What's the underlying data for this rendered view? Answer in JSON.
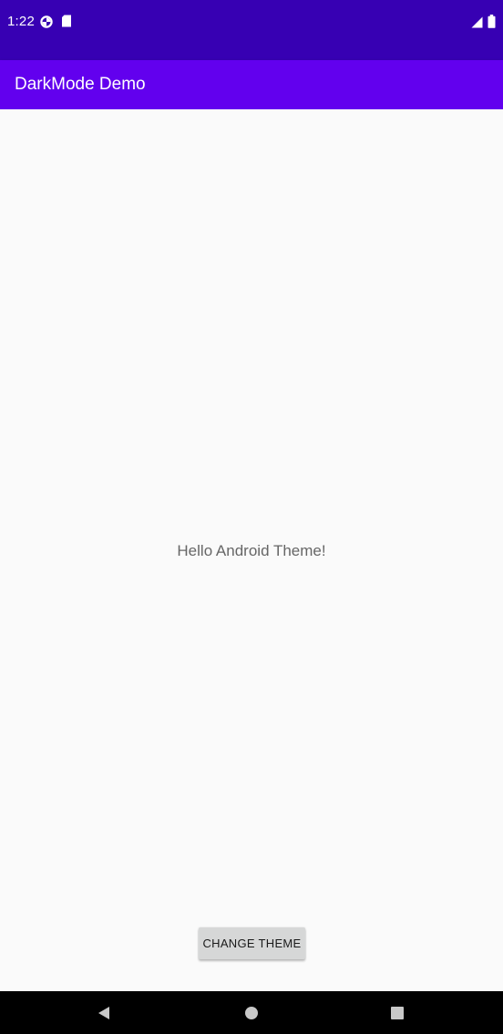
{
  "status_bar": {
    "time": "1:22",
    "background": "#3700b3",
    "icons_left": [
      "data-saver-icon",
      "sd-card-icon"
    ],
    "icons_right": [
      "signal-icon",
      "battery-icon"
    ]
  },
  "app_bar": {
    "title": "DarkMode Demo",
    "background": "#6200ee"
  },
  "main": {
    "message": "Hello Android Theme!",
    "button_label": "CHANGE THEME"
  },
  "nav_bar": {
    "buttons": [
      "back-icon",
      "home-icon",
      "recents-icon"
    ]
  }
}
